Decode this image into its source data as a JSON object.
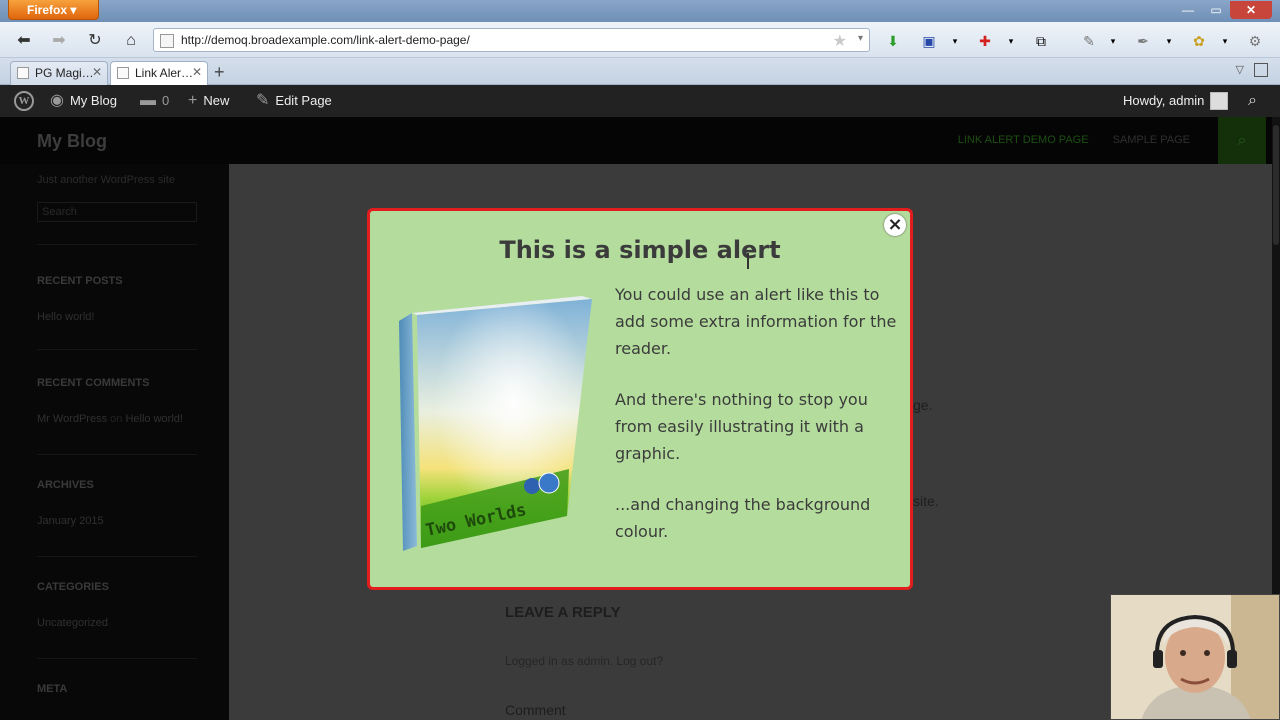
{
  "browser": {
    "app_button": "Firefox",
    "url": "http://demoq.broadexample.com/link-alert-demo-page/",
    "tabs": [
      {
        "label": "PG Magi…",
        "active": false
      },
      {
        "label": "Link Aler…",
        "active": true
      }
    ],
    "window_controls": {
      "minimize": "—",
      "maximize": "▭",
      "close": "✕"
    }
  },
  "adminbar": {
    "site": "My Blog",
    "comments_count": "0",
    "new_label": "New",
    "edit_label": "Edit Page",
    "greeting": "Howdy, admin"
  },
  "site": {
    "title": "My Blog",
    "tagline": "Just another WordPress site",
    "nav": [
      "LINK ALERT DEMO PAGE",
      "SAMPLE PAGE"
    ],
    "search_placeholder": "Search"
  },
  "sidebar": {
    "recent_posts_title": "RECENT POSTS",
    "recent_posts": [
      "Hello world!"
    ],
    "recent_comments_title": "RECENT COMMENTS",
    "recent_comment": {
      "author": "Mr WordPress",
      "on": "on",
      "post": "Hello world!"
    },
    "archives_title": "ARCHIVES",
    "archives": [
      "January 2015"
    ],
    "categories_title": "CATEGORIES",
    "categories": [
      "Uncategorized"
    ],
    "meta_title": "META"
  },
  "content": {
    "fragment_1": "ge.",
    "fragment_2": "site.",
    "reply_title": "LEAVE A REPLY",
    "logged_in": "Logged in as admin. Log out?",
    "comment_label": "Comment"
  },
  "modal": {
    "title": "This is a simple alert",
    "paragraphs": [
      "You could use an alert like this to add some extra information for the reader.",
      "And there's nothing to stop you from easily illustrating it with a graphic.",
      "...and changing the background colour."
    ],
    "book_label": "Two Worlds",
    "close_symbol": "×",
    "background_color": "#b4dd9d",
    "border_color": "#e21d1d"
  }
}
